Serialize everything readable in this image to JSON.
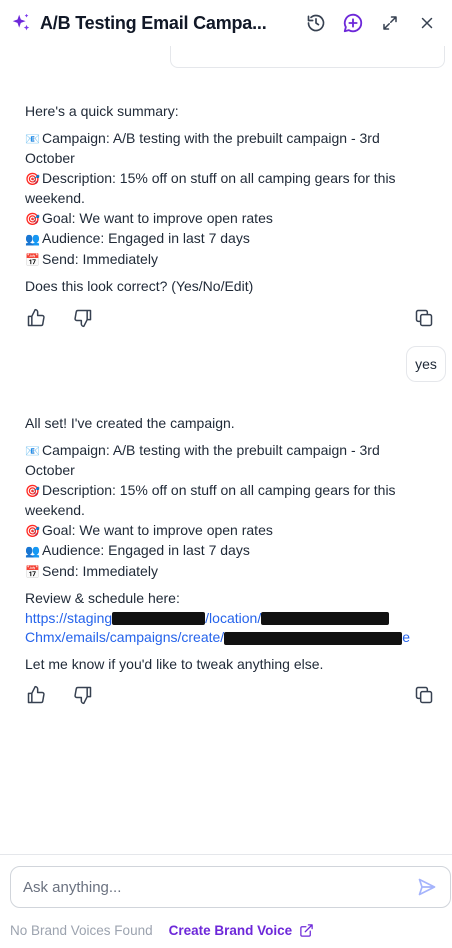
{
  "header": {
    "title": "A/B Testing Email Campa...",
    "icons": [
      "sparkle-icon",
      "history-icon",
      "new-chat-icon",
      "expand-icon",
      "close-icon"
    ]
  },
  "messages": [
    {
      "intro": "Here's a quick summary:",
      "lines": [
        {
          "emoji": "📧",
          "text": "Campaign: A/B testing with the prebuilt campaign - 3rd October"
        },
        {
          "emoji": "🎯",
          "text": "Description: 15% off on stuff on all camping gears for this weekend."
        },
        {
          "emoji": "🎯",
          "text": "Goal: We want to improve open rates"
        },
        {
          "emoji": "👥",
          "text": "Audience: Engaged in last 7 days"
        },
        {
          "emoji": "📅",
          "text": "Send: Immediately"
        }
      ],
      "question": "Does this look correct? (Yes/No/Edit)"
    },
    {
      "user_reply": "yes"
    },
    {
      "intro": "All set! I've created the campaign.",
      "lines": [
        {
          "emoji": "📧",
          "text": "Campaign: A/B testing with the prebuilt campaign - 3rd October"
        },
        {
          "emoji": "🎯",
          "text": "Description: 15% off on stuff on all camping gears for this weekend."
        },
        {
          "emoji": "🎯",
          "text": "Goal: We want to improve open rates"
        },
        {
          "emoji": "👥",
          "text": "Audience: Engaged in last 7 days"
        },
        {
          "emoji": "📅",
          "text": "Send: Immediately"
        }
      ],
      "review_label": "Review & schedule here:",
      "link_parts": [
        "https://staging",
        "/location/",
        "Chmx/emails/campaigns/create/",
        "e"
      ],
      "closing": "Let me know if you'd like to tweak anything else."
    }
  ],
  "composer": {
    "placeholder": "Ask anything..."
  },
  "footer": {
    "no_brand_voices": "No Brand Voices Found",
    "create_brand_voice": "Create Brand Voice"
  },
  "colors": {
    "accent": "#6d28d9",
    "link": "#2563eb",
    "send_icon": "#a5b4fc"
  }
}
